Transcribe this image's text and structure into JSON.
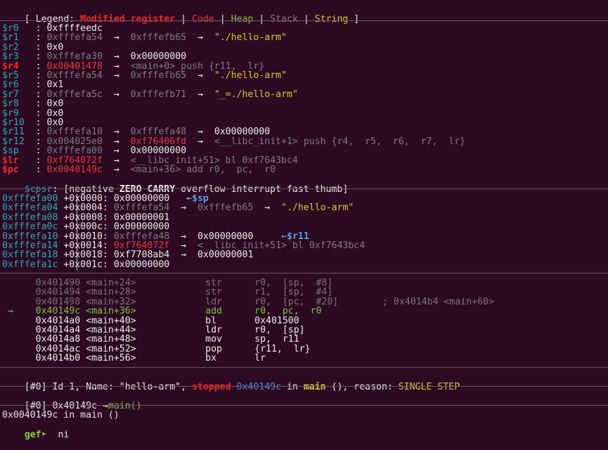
{
  "legend": {
    "open": "[ Legend: ",
    "modified": "Modified register",
    "sep1": " | ",
    "code": "Code",
    "sep2": " | ",
    "heap": "Heap",
    "sep3": " | ",
    "stack": "Stack",
    "sep4": " | ",
    "string": "String",
    "close": " ]"
  },
  "registers": [
    {
      "name": "$r0 ",
      "val": "0xffffeedc",
      "chain": []
    },
    {
      "name": "$r1 ",
      "val": "0xfffefa54",
      "chain": [
        {
          "a": "0xfffefb65",
          "c": "grey"
        },
        {
          "a": "\"./hello-arm\"",
          "c": "yellow"
        }
      ]
    },
    {
      "name": "$r2 ",
      "val": "0x0",
      "chain": []
    },
    {
      "name": "$r3 ",
      "val": "0xfffefa30",
      "chain": [
        {
          "a": "0x00000000",
          "c": "white"
        }
      ]
    },
    {
      "name": "$r4 ",
      "val": "0x00401478",
      "chain": [
        {
          "a": "<main+0> push {r11,  lr}",
          "c": "grey"
        }
      ]
    },
    {
      "name": "$r5 ",
      "val": "0xfffefa54",
      "chain": [
        {
          "a": "0xfffefb65",
          "c": "grey"
        },
        {
          "a": "\"./hello-arm\"",
          "c": "yellow"
        }
      ]
    },
    {
      "name": "$r6 ",
      "val": "0x1",
      "chain": []
    },
    {
      "name": "$r7 ",
      "val": "0xfffefa5c",
      "chain": [
        {
          "a": "0xfffefb71",
          "c": "grey"
        },
        {
          "a": "\"_=./hello-arm\"",
          "c": "yellow"
        }
      ]
    },
    {
      "name": "$r8 ",
      "val": "0x0",
      "chain": []
    },
    {
      "name": "$r9 ",
      "val": "0x0",
      "chain": []
    },
    {
      "name": "$r10",
      "val": "0x0",
      "chain": []
    },
    {
      "name": "$r11",
      "val": "0xfffefa10",
      "chain": [
        {
          "a": "0xfffefa48",
          "c": "grey"
        },
        {
          "a": "0x00000000",
          "c": "white"
        }
      ]
    },
    {
      "name": "$r12",
      "val": "0x004025e0",
      "chain": [
        {
          "a": "0xf76406fd",
          "c": "red"
        },
        {
          "a": "<__libc_init+1> push {r4,  r5,  r6,  r7,  lr}",
          "c": "grey"
        }
      ]
    },
    {
      "name": "$sp ",
      "val": "0xfffefa00",
      "chain": [
        {
          "a": "0x00000000",
          "c": "white"
        }
      ]
    },
    {
      "name": "$lr ",
      "val": "0xf764072f",
      "chain": [
        {
          "a": "<__libc_init+51> bl 0xf7643bc4",
          "c": "grey"
        }
      ]
    },
    {
      "name": "$pc ",
      "val": "0x0040149c",
      "chain": [
        {
          "a": "<main+36> add r0,  pc,  r0",
          "c": "grey"
        }
      ]
    }
  ],
  "cpsr": {
    "name": "$cpsr",
    "open": ": [negative ",
    "zero": "ZERO",
    "sp1": " ",
    "carry": "CARRY",
    "rest": " overflow interrupt fast thumb]"
  },
  "stack": [
    {
      "addr": "0xfffefa00",
      "off": "+0x0000:",
      "val": "0x00000000",
      "chain": [],
      "tag": "←$sp"
    },
    {
      "addr": "0xfffefa04",
      "off": "+0x0004:",
      "val": "0xfffefa54",
      "chain": [
        "0xfffefb65",
        "\"./hello-arm\""
      ],
      "tag": ""
    },
    {
      "addr": "0xfffefa08",
      "off": "+0x0008:",
      "val": "0x00000001",
      "chain": [],
      "tag": ""
    },
    {
      "addr": "0xfffefa0c",
      "off": "+0x000c:",
      "val": "0x00000000",
      "chain": [],
      "tag": ""
    },
    {
      "addr": "0xfffefa10",
      "off": "+0x0010:",
      "val": "0xfffefa48",
      "chain": [
        "0x00000000"
      ],
      "tag": "←$r11"
    },
    {
      "addr": "0xfffefa14",
      "off": "+0x0014:",
      "val": "0xf764072f",
      "chain": [
        "<__libc_init+51> bl 0xf7643bc4"
      ],
      "tag": ""
    },
    {
      "addr": "0xfffefa18",
      "off": "+0x0018:",
      "val": "0xf7708ab4",
      "chain": [
        "0x00000001"
      ],
      "tag": ""
    },
    {
      "addr": "0xfffefa1c",
      "off": "+0x001c:",
      "val": "0x00000000",
      "chain": [],
      "tag": ""
    }
  ],
  "code": [
    {
      "addr": "0x401490",
      "sym": "<main+24>",
      "op": "str",
      "args": "r0,  [sp,  #8]",
      "cmt": "",
      "state": "past"
    },
    {
      "addr": "0x401494",
      "sym": "<main+28>",
      "op": "str",
      "args": "r1,  [sp,  #4]",
      "cmt": "",
      "state": "past"
    },
    {
      "addr": "0x401498",
      "sym": "<main+32>",
      "op": "ldr",
      "args": "r0,  [pc,  #20]",
      "cmt": "; 0x4014b4 <main+60>",
      "state": "past"
    },
    {
      "addr": "0x40149c",
      "sym": "<main+36>",
      "op": "add",
      "args": "r0,  pc,  r0",
      "cmt": "",
      "state": "current"
    },
    {
      "addr": "0x4014a0",
      "sym": "<main+40>",
      "op": "bl",
      "args": "0x401500",
      "cmt": "",
      "state": "next"
    },
    {
      "addr": "0x4014a4",
      "sym": "<main+44>",
      "op": "ldr",
      "args": "r0,  [sp]",
      "cmt": "",
      "state": "next"
    },
    {
      "addr": "0x4014a8",
      "sym": "<main+48>",
      "op": "mov",
      "args": "sp,  r11",
      "cmt": "",
      "state": "next"
    },
    {
      "addr": "0x4014ac",
      "sym": "<main+52>",
      "op": "pop",
      "args": "{r11,  lr}",
      "cmt": "",
      "state": "next"
    },
    {
      "addr": "0x4014b0",
      "sym": "<main+56>",
      "op": "bx",
      "args": "lr",
      "cmt": "",
      "state": "next"
    }
  ],
  "arrow": "→",
  "chain_arrow": "→",
  "thread": {
    "idx": "[#0]",
    "text1": " Id 1, Name: ",
    "name": "\"hello-arm\"",
    "sep": ", ",
    "state": "stopped",
    "sp": " ",
    "addr": "0x40149c",
    "in": " in ",
    "func": "main",
    "text2": " (), reason: ",
    "reason": "SINGLE STEP"
  },
  "trace": {
    "idx": "[#0]",
    "addr": " 0x40149c ",
    "arrow": "→",
    "func": "main()"
  },
  "status": "0x0040149c in main ()",
  "prompt": {
    "label": "gef➤",
    "cmd": "  ni"
  }
}
